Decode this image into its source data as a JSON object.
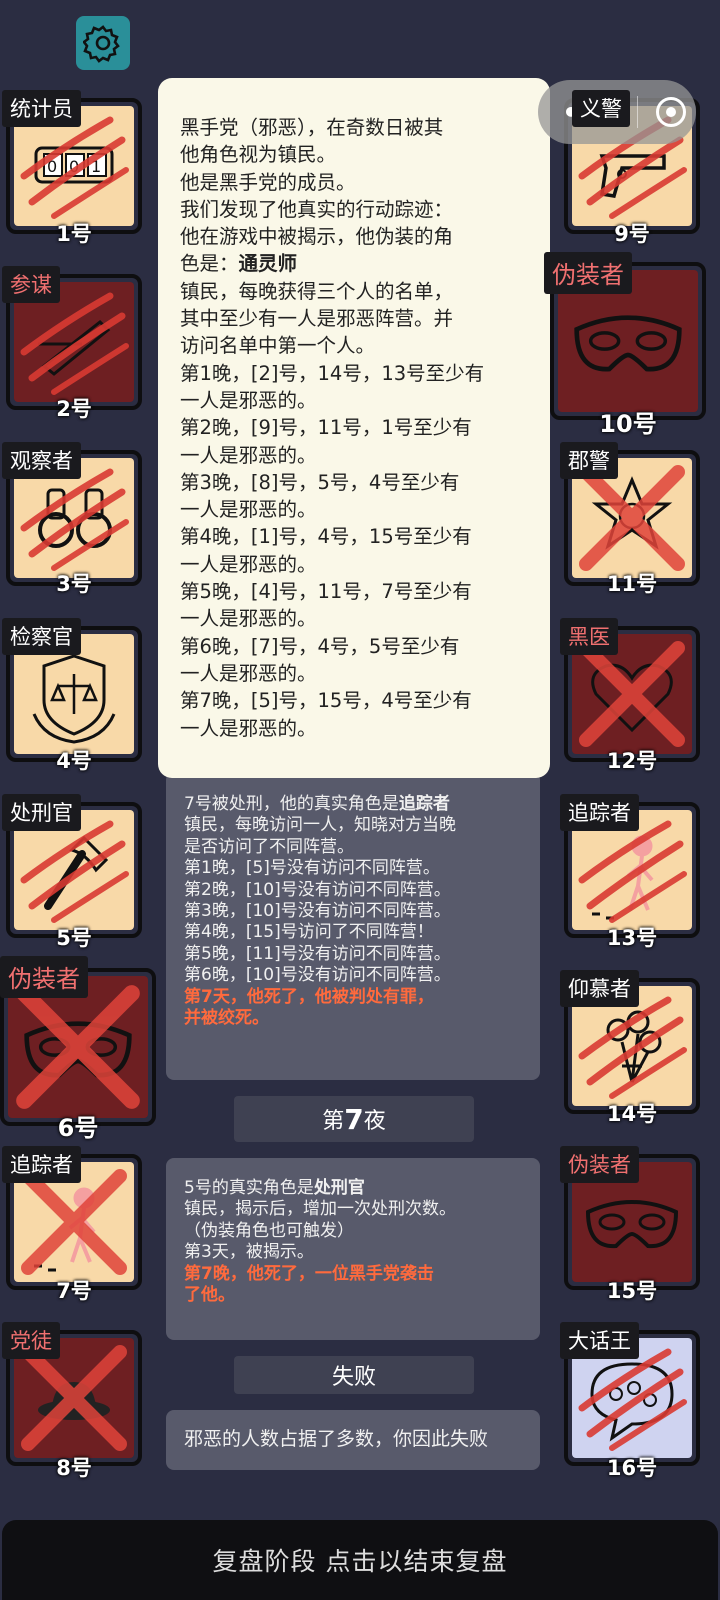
{
  "toolbar": {
    "settings_icon": "gear-icon"
  },
  "capsule": {
    "more_label": "•••",
    "close_icon": "target-icon"
  },
  "players_left": [
    {
      "role": "统计员",
      "num": "1号",
      "icon": "counter-icon",
      "faction": "good",
      "status": "scratched"
    },
    {
      "role": "参谋",
      "num": "2号",
      "icon": "pen-icon",
      "faction": "evil",
      "status": "scratched"
    },
    {
      "role": "观察者",
      "num": "3号",
      "icon": "binoculars-icon",
      "faction": "good",
      "status": "scratched"
    },
    {
      "role": "检察官",
      "num": "4号",
      "icon": "justice-shield-icon",
      "faction": "good",
      "status": "alive"
    },
    {
      "role": "处刑官",
      "num": "5号",
      "icon": "axe-icon",
      "faction": "good",
      "status": "scratched"
    },
    {
      "role": "伪装者",
      "num": "6号",
      "icon": "mask-icon",
      "faction": "evil",
      "status": "dead"
    },
    {
      "role": "追踪者",
      "num": "7号",
      "icon": "stickman-icon",
      "faction": "good",
      "status": "dead"
    },
    {
      "role": "党徒",
      "num": "8号",
      "icon": "hat-icon",
      "faction": "evil",
      "status": "dead"
    }
  ],
  "players_right": [
    {
      "role": "义警",
      "num": "9号",
      "icon": "gun-icon",
      "faction": "good",
      "status": "scratched"
    },
    {
      "role": "伪装者",
      "num": "10号",
      "icon": "mask-icon",
      "faction": "evil",
      "status": "alive"
    },
    {
      "role": "郡警",
      "num": "11号",
      "icon": "sheriff-star-icon",
      "faction": "good",
      "status": "dead"
    },
    {
      "role": "黑医",
      "num": "12号",
      "icon": "heart-icon",
      "faction": "evil",
      "status": "dead"
    },
    {
      "role": "追踪者",
      "num": "13号",
      "icon": "stickman-icon",
      "faction": "good",
      "status": "scratched"
    },
    {
      "role": "仰慕者",
      "num": "14号",
      "icon": "bouquet-icon",
      "faction": "good",
      "status": "scratched"
    },
    {
      "role": "伪装者",
      "num": "15号",
      "icon": "mask-icon",
      "faction": "evil",
      "status": "alive"
    },
    {
      "role": "大话王",
      "num": "16号",
      "icon": "speech-bubble-icon",
      "faction": "neutral",
      "status": "scratched"
    }
  ],
  "popup": {
    "lines": [
      "黑手党（邪恶），在奇数日被其",
      "他角色视为镇民。",
      "他是黑手党的成员。",
      "我们发现了他真实的行动踪迹：",
      "他在游戏中被揭示，他伪装的角",
      "色是：",
      "镇民，每晚获得三个人的名单，",
      "其中至少有一人是邪恶阵营。并",
      "访问名单中第一个人。",
      "第1晚，[2]号，14号，13号至少有",
      "一人是邪恶的。",
      "第2晚，[9]号，11号，1号至少有",
      "一人是邪恶的。",
      "第3晚，[8]号，5号，4号至少有",
      "一人是邪恶的。",
      "第4晚，[1]号，4号，15号至少有",
      "一人是邪恶的。",
      "第5晚，[4]号，11号，7号至少有",
      "一人是邪恶的。",
      "第6晚，[7]号，4号，5号至少有",
      "一人是邪恶的。",
      "第7晚，[5]号，15号，4号至少有",
      "一人是邪恶的。"
    ],
    "disguise_role": "通灵师"
  },
  "log": {
    "block1": {
      "intro": "7号被处刑，他的真实角色是",
      "role": "追踪者",
      "lines": [
        "镇民，每晚访问一人，知晓对方当晚",
        "是否访问了不同阵营。",
        "第1晚，[5]号没有访问不同阵营。",
        "第2晚，[10]号没有访问不同阵营。",
        "第3晚，[10]号没有访问不同阵营。",
        "第4晚，[15]号访问了不同阵营！",
        "第5晚，[11]号没有访问不同阵营。",
        "第6晚，[10]号没有访问不同阵营。"
      ],
      "red": [
        "第7天，他死了，他被判处有罪，",
        "并被绞死。"
      ]
    },
    "night_prefix": "第",
    "night_num": "7",
    "night_suffix": "夜",
    "block2": {
      "intro": "5号的真实角色是",
      "role": "处刑官",
      "lines": [
        "镇民，揭示后，增加一次处刑次数。",
        "（伪装角色也可触发）",
        "第3天，被揭示。"
      ],
      "red": [
        "第7晚，他死了，一位黑手党袭击",
        "了他。"
      ]
    },
    "result_label": "失败",
    "result_text": "邪恶的人数占据了多数，你因此失败"
  },
  "bottom_bar": "复盘阶段 点击以结束复盘",
  "colors": {
    "background": "#2b2d42",
    "good": "#f8d9a8",
    "evil": "#6e1f22",
    "death_red": "#e0443a",
    "log_red": "#ff6a3d"
  }
}
